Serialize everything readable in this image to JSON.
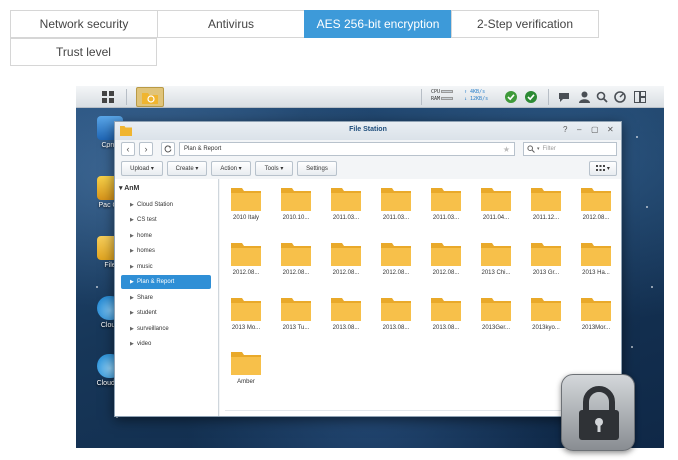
{
  "tabs": [
    {
      "label": "Network security",
      "active": false
    },
    {
      "label": "Antivirus",
      "active": false
    },
    {
      "label": "AES 256-bit encryption",
      "active": true
    },
    {
      "label": "2-Step verification",
      "active": false
    },
    {
      "label": "Trust level",
      "active": false
    }
  ],
  "colors": {
    "accent": "#3d9ad9",
    "folder": "#f7c04a",
    "selection": "#2f8fd6"
  },
  "taskbar": {
    "cpu_label": "CPU",
    "ram_label": "RAM",
    "upload": "4KB/s",
    "download": "12KB/s"
  },
  "desktop_icons": [
    {
      "label": "Contr",
      "icon": "control-panel-icon"
    },
    {
      "label": "Pac Ce",
      "icon": "package-center-icon"
    },
    {
      "label": "File",
      "icon": "file-station-icon"
    },
    {
      "label": "Cloud",
      "icon": "cloud-icon"
    },
    {
      "label": "Cloud St",
      "icon": "cloud-station-icon"
    }
  ],
  "window": {
    "title": "File Station",
    "path": "Plan & Report",
    "filter_placeholder": "Filter",
    "toolbar": {
      "upload": "Upload",
      "create": "Create",
      "action": "Action",
      "tools": "Tools",
      "settings": "Settings"
    },
    "tree_root": "AnM",
    "tree": [
      {
        "label": "Cloud Station",
        "selected": false
      },
      {
        "label": "CS test",
        "selected": false
      },
      {
        "label": "home",
        "selected": false
      },
      {
        "label": "homes",
        "selected": false
      },
      {
        "label": "music",
        "selected": false
      },
      {
        "label": "Plan & Report",
        "selected": true
      },
      {
        "label": "Share",
        "selected": false
      },
      {
        "label": "student",
        "selected": false
      },
      {
        "label": "surveillance",
        "selected": false
      },
      {
        "label": "video",
        "selected": false
      }
    ],
    "folders": [
      "2010 Italy",
      "2010.10...",
      "2011.03...",
      "2011.03...",
      "2011.03...",
      "2011.04...",
      "2011.12...",
      "2012.08...",
      "2012.08...",
      "2012.08...",
      "2012.08...",
      "2012.08...",
      "2012.08...",
      "2013 Chi...",
      "2013 Gr...",
      "2013 Ha...",
      "2013 Mo...",
      "2013 Tu...",
      "2013.08...",
      "2013.08...",
      "2013.08...",
      "2013Ger...",
      "2013kyo...",
      "2013Mor...",
      "Amber"
    ]
  }
}
